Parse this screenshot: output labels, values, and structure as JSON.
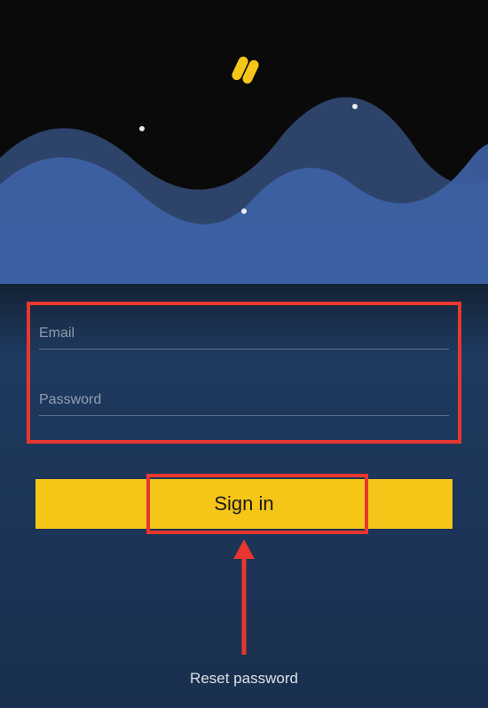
{
  "logo": {
    "name": "app-logo-icon",
    "color": "#f5c518"
  },
  "form": {
    "email": {
      "placeholder": "Email",
      "value": ""
    },
    "password": {
      "placeholder": "Password",
      "value": ""
    }
  },
  "buttons": {
    "signin_label": "Sign in",
    "reset_label": "Reset password"
  },
  "annotation": {
    "highlight_color": "#e8372f"
  }
}
